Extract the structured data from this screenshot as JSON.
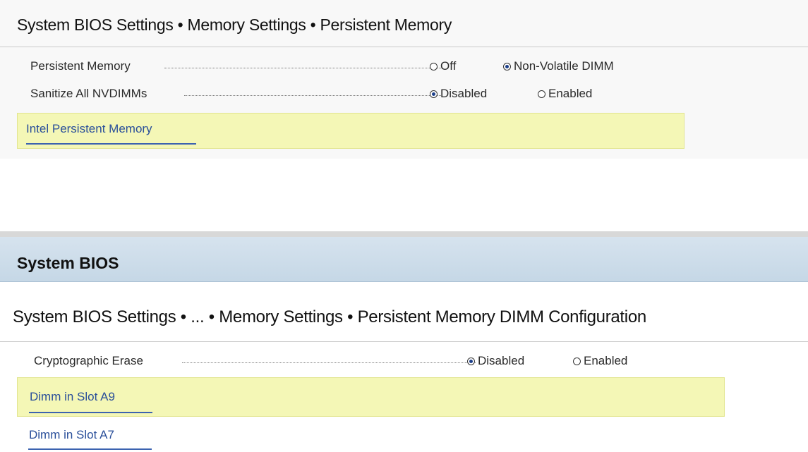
{
  "top": {
    "breadcrumb": "System BIOS Settings • Memory Settings • Persistent Memory",
    "settings": [
      {
        "label": "Persistent Memory",
        "options": [
          {
            "label": "Off",
            "selected": false
          },
          {
            "label": "Non-Volatile DIMM",
            "selected": true
          }
        ]
      },
      {
        "label": "Sanitize All NVDIMMs",
        "options": [
          {
            "label": "Disabled",
            "selected": true
          },
          {
            "label": "Enabled",
            "selected": false
          }
        ]
      }
    ],
    "link": "Intel Persistent Memory"
  },
  "bottom": {
    "title": "System BIOS",
    "breadcrumb": "System BIOS Settings • ... • Memory Settings • Persistent Memory DIMM Configuration",
    "settings": [
      {
        "label": "Cryptographic Erase",
        "options": [
          {
            "label": "Disabled",
            "selected": true
          },
          {
            "label": "Enabled",
            "selected": false
          }
        ]
      }
    ],
    "links": [
      "Dimm in Slot A9",
      "Dimm in Slot A7"
    ]
  },
  "colors": {
    "highlight": "#f4f7b6",
    "link": "#2a4f9a",
    "titlebar": "#c5d7e6"
  }
}
